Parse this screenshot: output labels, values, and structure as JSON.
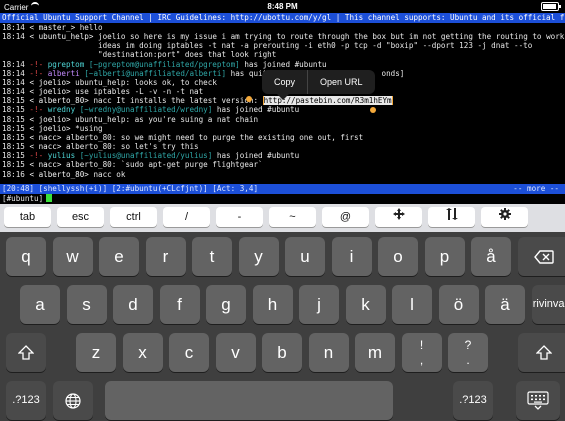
{
  "status_bar": {
    "carrier": "Carrier",
    "time": "8:48 PM",
    "battery_level": 0.9
  },
  "terminal": {
    "topic": "Official Ubuntu Support Channel | IRC Guidelines: http://ubottu.com/y/gl | This channel supports: Ubuntu and its official flavo",
    "lines": [
      {
        "time": "18:14",
        "pre": " ",
        "nick": "< master_>",
        "text": " hello"
      },
      {
        "time": "18:14",
        "pre": " ",
        "nick": "< ubuntu_help>",
        "text": " joelio so here is my issue i am trying to route through the box but im not getting the routing to work any"
      },
      {
        "cont": "ideas im doing iptables -t nat -a prerouting -i eth0 -p tcp -d \"boxip\" --dport 123 -j dnat --to"
      },
      {
        "cont": "\"destination:port\" does that look right"
      },
      {
        "time": "18:14",
        "type": "join",
        "nick": "pgreptom",
        "host": "[~pgreptom@unaffiliated/pgreptom]",
        "text": " has joined #ubuntu"
      },
      {
        "time": "18:14",
        "type": "quit",
        "nick": "alberti",
        "host": "[~alberti@unaffiliated/alberti]",
        "text": " has quit [",
        "tail": "onds]"
      },
      {
        "time": "18:14",
        "pre": " ",
        "nick": "< joelio>",
        "text": " ubuntu_help: looks ok, to check"
      },
      {
        "time": "18:14",
        "pre": " ",
        "nick": "< joelio>",
        "text": " use iptables -L -v -n -t nat"
      },
      {
        "time": "18:15",
        "pre": " ",
        "nick": "< alberto_80>",
        "text": " nacc It installs the latest version: ",
        "link": "http://pastebin.com/R3m1hEYm"
      },
      {
        "time": "18:15",
        "type": "join",
        "nick": "wredny",
        "host": "[~wredny@unaffiliated/wredny]",
        "text": " has joined #ubuntu"
      },
      {
        "time": "18:15",
        "pre": " ",
        "nick": "< joelio>",
        "text": " ubuntu_help: as you're suing a nat chain"
      },
      {
        "time": "18:15",
        "pre": " ",
        "nick": "< joelio>",
        "text": " *using"
      },
      {
        "time": "18:15",
        "pre": " ",
        "nick": "< nacc>",
        "text": " alberto_80: so we might need to purge the existing one out, first"
      },
      {
        "time": "18:15",
        "pre": " ",
        "nick": "< nacc>",
        "text": " alberto_80: so let's try this"
      },
      {
        "time": "18:15",
        "type": "join",
        "nick": "yulius",
        "host": "[~yulius@unaffiliated/yulius]",
        "text": " has joined #ubuntu"
      },
      {
        "time": "18:15",
        "pre": " ",
        "nick": "< nacc>",
        "text": " alberto_80: `sudo apt-get purge flightgear`"
      },
      {
        "time": "18:16",
        "pre": " ",
        "nick": "< alberto_80>",
        "text": " nacc ok"
      }
    ],
    "statusbar_left": "[20:48] [shellyssh(+i)] [2:#ubuntu(+CLcfjnt)] [Act: 3,4]",
    "statusbar_right": "-- more --",
    "input_prompt": "[#ubuntu]"
  },
  "popup": {
    "copy": "Copy",
    "open_url": "Open URL"
  },
  "accessory_bar": {
    "keys": [
      {
        "label": "tab"
      },
      {
        "label": "esc"
      },
      {
        "label": "ctrl"
      },
      {
        "label": "/"
      },
      {
        "label": "-"
      },
      {
        "label": "~"
      },
      {
        "label": "@"
      },
      {
        "icon": "move-arrows-icon"
      },
      {
        "icon": "swap-arrows-icon"
      },
      {
        "icon": "gear-icon"
      }
    ]
  },
  "keyboard": {
    "row1": [
      "q",
      "w",
      "e",
      "r",
      "t",
      "y",
      "u",
      "i",
      "o",
      "p",
      "å"
    ],
    "row2": [
      "a",
      "s",
      "d",
      "f",
      "g",
      "h",
      "j",
      "k",
      "l",
      "ö",
      "ä"
    ],
    "row3": [
      "z",
      "x",
      "c",
      "v",
      "b",
      "n",
      "m"
    ],
    "punct1": {
      "top": "!",
      "bottom": ","
    },
    "punct2": {
      "top": "?",
      "bottom": "."
    },
    "return_label": "rivinvaihto",
    "numbers_label": ".?123",
    "icons": {
      "backspace": "backspace-icon",
      "shift": "shift-icon",
      "globe": "globe-icon",
      "hide": "keyboard-hide-icon"
    }
  }
}
